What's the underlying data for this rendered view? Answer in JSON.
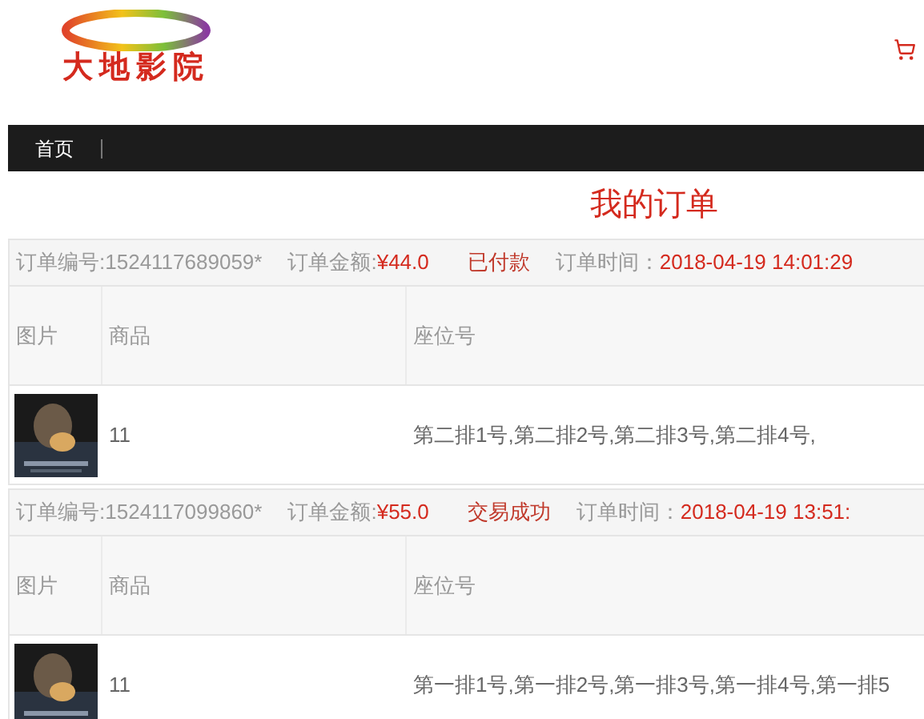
{
  "logo": {
    "text": "大地影院"
  },
  "nav": [
    {
      "label": "首页"
    }
  ],
  "page_title": "我的订单",
  "orders": [
    {
      "table_headers": [
        "图片",
        "商品",
        "座位号"
      ],
      "order_no_label": "订单编号:",
      "order_no": "1524117689059*",
      "amount_label": "订单金额:",
      "amount": "¥44.0",
      "status": "已付款",
      "time_label": "订单时间：",
      "time": "2018-04-19 14:01:29",
      "items": [
        {
          "kind": "picture",
          "name": "11",
          "seats": "第二排1号,第二排2号,第二排3号,第二排4号,"
        }
      ]
    },
    {
      "table_headers": [
        "图片",
        "商品",
        "座位号"
      ],
      "order_no_label": "订单编号:",
      "order_no": "1524117099860*",
      "amount_label": "订单金额:",
      "amount": "¥55.0",
      "status": "交易成功",
      "time_label": "订单时间：",
      "time": "2018-04-19 13:51:",
      "items": [
        {
          "kind": "picture",
          "name": "11",
          "seats": "第一排1号,第一排2号,第一排3号,第一排4号,第一排5"
        }
      ]
    }
  ]
}
